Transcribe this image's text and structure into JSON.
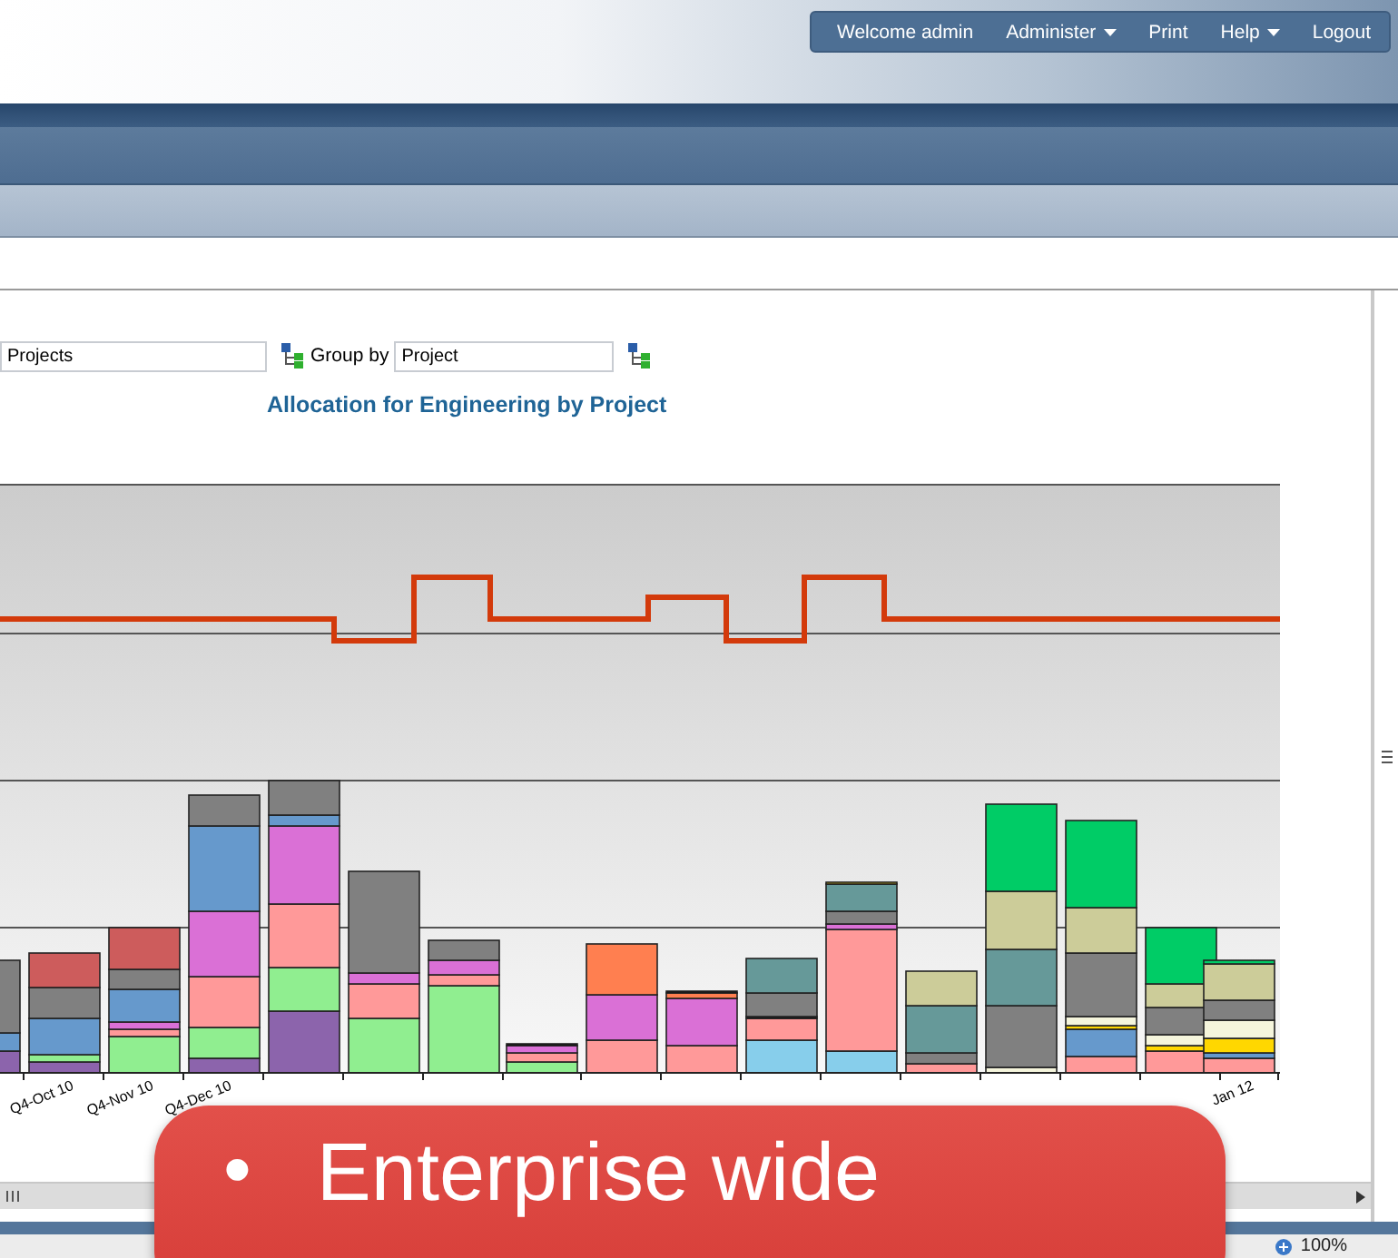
{
  "top_nav": [
    {
      "label": "Welcome admin",
      "has_menu": false
    },
    {
      "label": "Administer",
      "has_menu": true
    },
    {
      "label": "Print",
      "has_menu": false
    },
    {
      "label": "Help",
      "has_menu": true
    },
    {
      "label": "Logout",
      "has_menu": false
    }
  ],
  "filters": {
    "first_value": "Projects",
    "group_by_label": "Group by",
    "group_by_value": "Project"
  },
  "chart": {
    "title": "Allocation for Engineering by Project",
    "axis_labels": [
      "Q4-Oct 10",
      "Q4-Nov 10",
      "Q4-Dec 10",
      "Jan 12"
    ]
  },
  "status_bar": {
    "zoom": "100%"
  },
  "callout": {
    "bullet": "•",
    "text": "Enterprise wide"
  }
}
